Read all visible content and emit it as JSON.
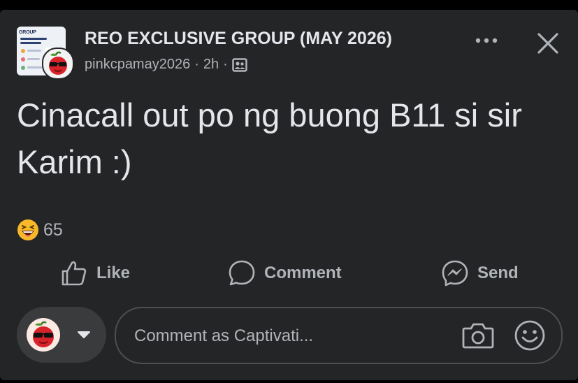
{
  "post": {
    "group_name": "REO EXCLUSIVE GROUP (MAY 2026)",
    "author": "pinkcpamay2026",
    "time": "2h",
    "separator": "·",
    "body": "Cinacall out po ng buong B11 si sir Karim :)",
    "thumbnail_text": "GROUP"
  },
  "reactions": {
    "count": "65",
    "emoji": "grinning-squinting-face"
  },
  "actions": {
    "like_label": "Like",
    "comment_label": "Comment",
    "send_label": "Send"
  },
  "composer": {
    "placeholder": "Comment as Captivati..."
  },
  "icons": {
    "more": "more-options-icon",
    "close": "close-icon",
    "audience": "group-members-icon",
    "like": "thumbs-up-icon",
    "comment": "speech-bubble-icon",
    "send": "messenger-icon",
    "camera": "camera-icon",
    "emoji": "smiley-icon",
    "caret": "caret-down-icon"
  },
  "colors": {
    "background": "#000000",
    "card": "#242526",
    "text_primary": "#e4e6eb",
    "text_secondary": "#b0b3b8",
    "pill": "#3a3b3c"
  }
}
